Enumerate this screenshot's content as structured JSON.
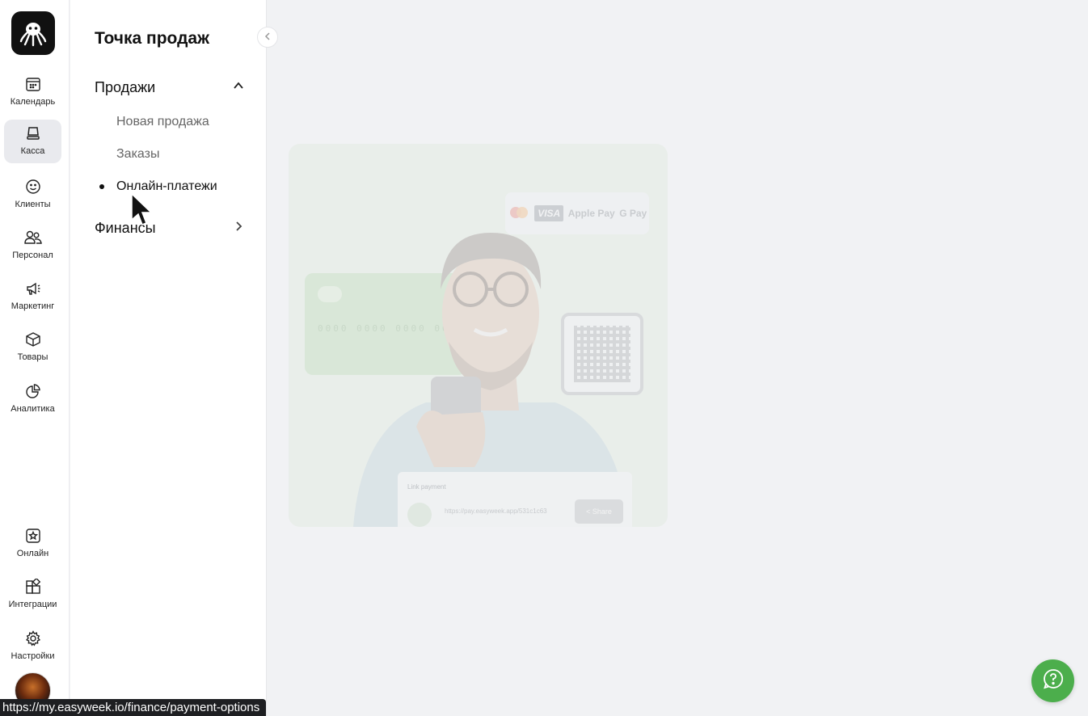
{
  "rail": {
    "items": [
      {
        "label": "Календарь",
        "icon": "calendar-icon"
      },
      {
        "label": "Касса",
        "icon": "cash-register-icon",
        "active": true
      },
      {
        "label": "Клиенты",
        "icon": "smile-icon"
      },
      {
        "label": "Персонал",
        "icon": "staff-icon"
      },
      {
        "label": "Маркетинг",
        "icon": "megaphone-icon"
      },
      {
        "label": "Товары",
        "icon": "box-icon"
      },
      {
        "label": "Аналитика",
        "icon": "pie-chart-icon"
      },
      {
        "label": "Онлайн",
        "icon": "star-window-icon"
      },
      {
        "label": "Интеграции",
        "icon": "integrations-icon"
      },
      {
        "label": "Настройки",
        "icon": "gear-icon"
      }
    ]
  },
  "sidebar": {
    "title": "Точка продаж",
    "groups": [
      {
        "label": "Продажи",
        "expanded": true,
        "items": [
          "Новая продажа",
          "Заказы",
          "Онлайн-платежи"
        ],
        "active_item": "Онлайн-платежи"
      },
      {
        "label": "Финансы",
        "expanded": false
      }
    ]
  },
  "promo": {
    "badges": [
      "VISA",
      "Apple Pay",
      "G Pay"
    ],
    "card_number": "0000 0000 0000 00",
    "link_title": "Link payment",
    "link_url": "https://pay.easyweek.app/531c1c63",
    "share_label": "Share"
  },
  "status_bar": {
    "url": "https://my.easyweek.io/finance/payment-options"
  },
  "colors": {
    "accent_green": "#4cae4c",
    "active_bg": "#e9eaee"
  }
}
